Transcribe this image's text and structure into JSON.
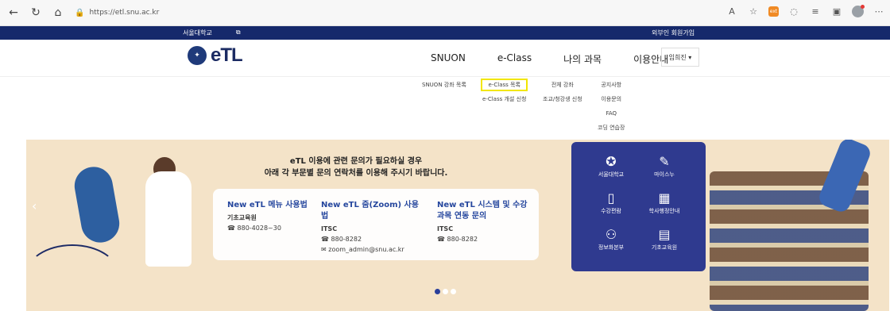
{
  "browser": {
    "url": "https://etl.snu.ac.kr",
    "icons": [
      "back-icon",
      "refresh-icon",
      "home-icon",
      "lock-icon",
      "read-aloud-icon",
      "favorite-add-icon",
      "extension-icon",
      "sync-icon",
      "favorites-icon",
      "collections-icon",
      "profile-icon",
      "more-icon"
    ]
  },
  "util_bar": {
    "university": "서울대학교",
    "signup": "외부인 회원가입"
  },
  "header": {
    "logo_text": "eTL",
    "nav": [
      "SNUON",
      "e-Class",
      "나의 과목",
      "이용안내"
    ],
    "user": "임희진 ▾"
  },
  "submenu": {
    "snuon": [
      "SNUON 강좌 목록"
    ],
    "eclass": [
      "e-Class 목록",
      "e-Class 개설 신청"
    ],
    "mycourse": [
      "전체 강좌",
      "조교/청강생 신청"
    ],
    "guide": [
      "공지사항",
      "이용문의",
      "FAQ",
      "코딩 연습장"
    ]
  },
  "banner": {
    "intro_line1": "eTL 이용에 관련 문의가 필요하실 경우",
    "intro_line2": "아래 각 부문별 문의 연락처를 이용해 주시기 바랍니다.",
    "contacts": [
      {
        "title": "New eTL 메뉴 사용법",
        "org": "기초교육원",
        "phone": "880-4028~30"
      },
      {
        "title": "New eTL 줌(Zoom) 사용법",
        "org": "ITSC",
        "phone": "880-8282",
        "email": "zoom_admin@snu.ac.kr"
      },
      {
        "title": "New eTL 시스템 및 수강과목 연동 문의",
        "org": "ITSC",
        "phone": "880-8282"
      }
    ],
    "quick_links": [
      "서울대학교",
      "마이스누",
      "수강편람",
      "학사행정안내",
      "정보화본부",
      "기초교육원"
    ]
  },
  "colors": {
    "navy": "#16296b",
    "highlight": "#f2e600",
    "banner_bg": "#f4e3c8",
    "panel": "#2f3a8f"
  }
}
